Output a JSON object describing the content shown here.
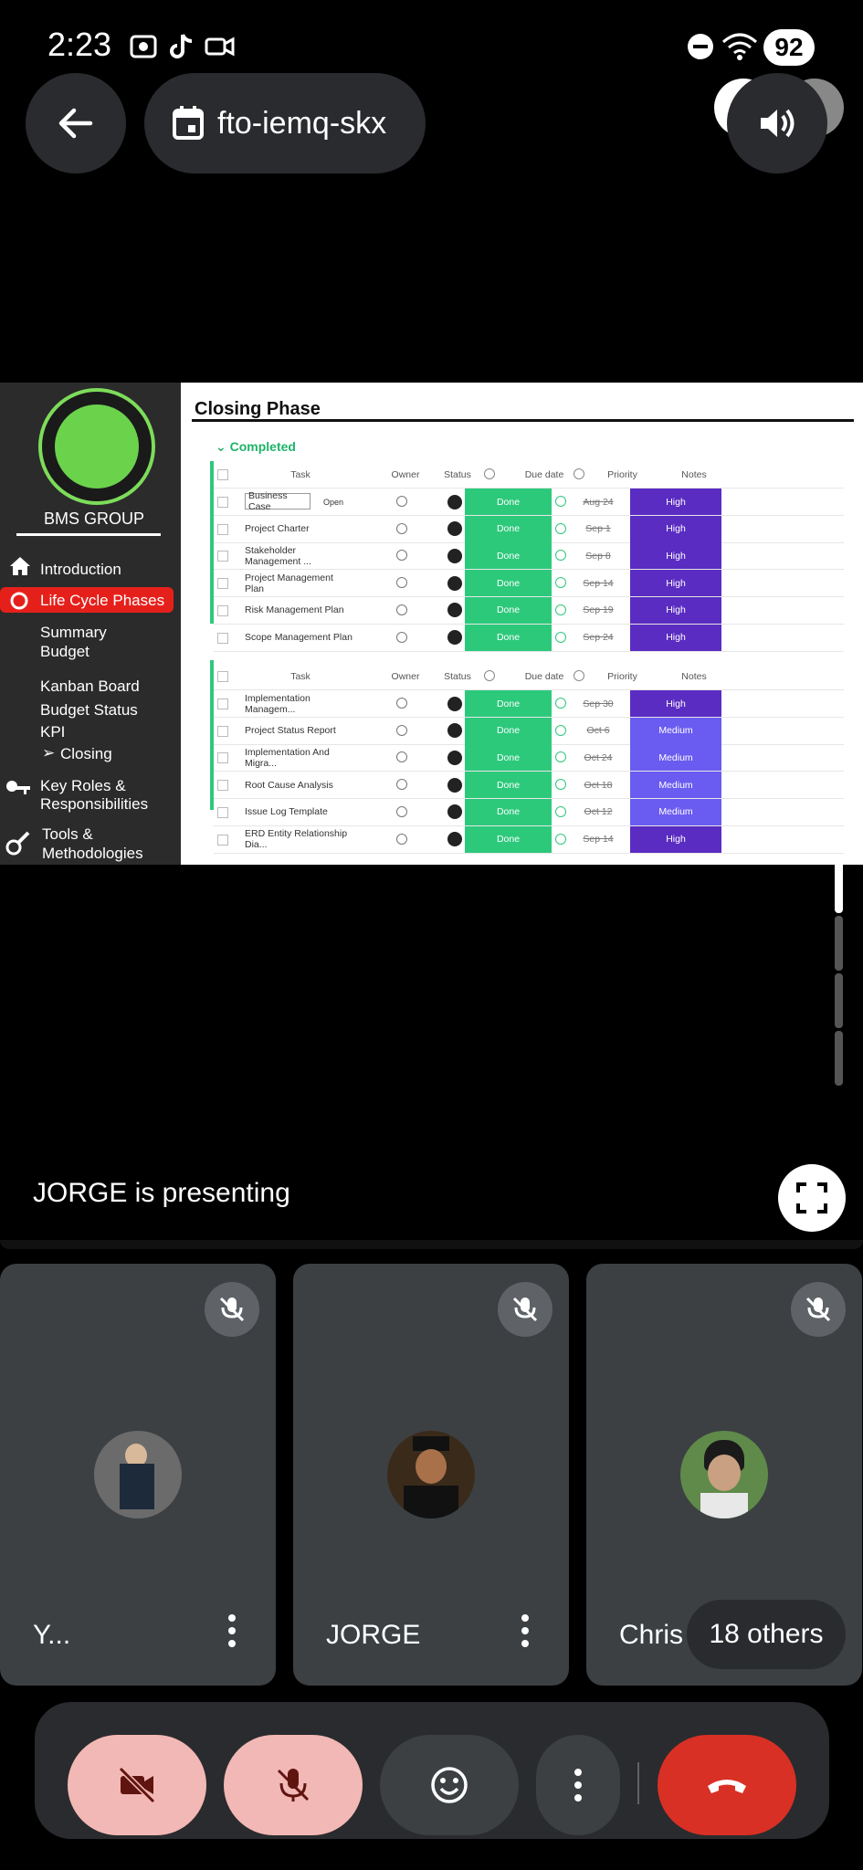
{
  "status_bar": {
    "time": "2:23",
    "battery": "92"
  },
  "meeting": {
    "code": "fto-iemq-skx"
  },
  "presentation": {
    "presenter_text": "JORGE is presenting",
    "slide": {
      "title": "Closing Phase",
      "group_label": "Completed",
      "sidebar": {
        "group_name": "BMS GROUP",
        "items": [
          "Introduction",
          "Life Cycle Phases",
          "Summary",
          "Budget",
          "Kanban Board",
          "Budget Status",
          "KPI",
          "Closing",
          "Key Roles &",
          "Responsibilities",
          "Tools &",
          "Methodologies"
        ]
      },
      "columns": {
        "task": "Task",
        "owner": "Owner",
        "status": "Status",
        "due": "Due date",
        "priority": "Priority",
        "notes": "Notes"
      },
      "open_label": "Open",
      "table1": [
        {
          "task": "Business Case",
          "status": "Done",
          "due": "Aug 24",
          "priority": "High"
        },
        {
          "task": "Project Charter",
          "status": "Done",
          "due": "Sep 1",
          "priority": "High"
        },
        {
          "task": "Stakeholder Management ...",
          "status": "Done",
          "due": "Sep 8",
          "priority": "High"
        },
        {
          "task": "Project Management Plan",
          "status": "Done",
          "due": "Sep 14",
          "priority": "High"
        },
        {
          "task": "Risk Management Plan",
          "status": "Done",
          "due": "Sep 19",
          "priority": "High"
        },
        {
          "task": "Scope Management Plan",
          "status": "Done",
          "due": "Sep 24",
          "priority": "High"
        }
      ],
      "table2": [
        {
          "task": "Implementation Managem...",
          "status": "Done",
          "due": "Sep 30",
          "priority": "High"
        },
        {
          "task": "Project Status Report",
          "status": "Done",
          "due": "Oct 6",
          "priority": "Medium"
        },
        {
          "task": "Implementation And Migra...",
          "status": "Done",
          "due": "Oct 24",
          "priority": "Medium"
        },
        {
          "task": "Root Cause Analysis",
          "status": "Done",
          "due": "Oct 18",
          "priority": "Medium"
        },
        {
          "task": "Issue Log Template",
          "status": "Done",
          "due": "Oct 12",
          "priority": "Medium"
        },
        {
          "task": "ERD Entity Relationship Dia...",
          "status": "Done",
          "due": "Sep 14",
          "priority": "High"
        }
      ]
    }
  },
  "participants": [
    {
      "name": "Y...",
      "muted": true
    },
    {
      "name": "JORGE",
      "muted": true
    },
    {
      "name": "Chris",
      "muted": true
    }
  ],
  "others_label": "18 others",
  "colors": {
    "end_call": "#d93025",
    "muted_button": "#f2b8b5",
    "status_done": "#2dc97b",
    "priority_high": "#5a2cc2",
    "priority_medium": "#6a5cf0"
  }
}
